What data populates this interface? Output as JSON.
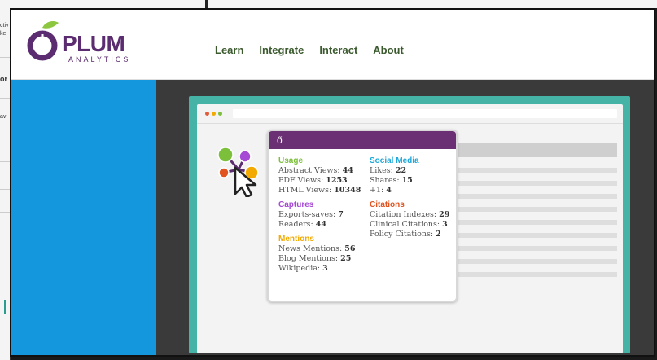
{
  "background_window": {
    "fragments": [
      "ctiv",
      "ke",
      "or",
      "av"
    ]
  },
  "site": {
    "logo": {
      "name": "PLUM",
      "tagline": "ANALYTICS"
    },
    "nav": [
      {
        "label": "Learn"
      },
      {
        "label": "Integrate"
      },
      {
        "label": "Interact"
      },
      {
        "label": "About"
      }
    ]
  },
  "card": {
    "icon": "ő",
    "usage": {
      "label": "Usage",
      "items": [
        {
          "name": "Abstract Views:",
          "value": "44"
        },
        {
          "name": "PDF Views:",
          "value": "1253"
        },
        {
          "name": "HTML Views:",
          "value": "10348"
        }
      ]
    },
    "captures": {
      "label": "Captures",
      "items": [
        {
          "name": "Exports-saves:",
          "value": "7"
        },
        {
          "name": "Readers:",
          "value": "44"
        }
      ]
    },
    "mentions": {
      "label": "Mentions",
      "items": [
        {
          "name": "News Mentions:",
          "value": "56"
        },
        {
          "name": "Blog Mentions:",
          "value": "25"
        },
        {
          "name": "Wikipedia:",
          "value": "3"
        }
      ]
    },
    "social_media": {
      "label": "Social Media",
      "items": [
        {
          "name": "Likes:",
          "value": "22"
        },
        {
          "name": "Shares:",
          "value": "15"
        },
        {
          "name": "+1:",
          "value": "4"
        }
      ]
    },
    "citations": {
      "label": "Citations",
      "items": [
        {
          "name": "Citation Indexes:",
          "value": "29"
        },
        {
          "name": "Clinical Citations:",
          "value": "3"
        },
        {
          "name": "Policy Citations:",
          "value": "2"
        }
      ]
    }
  },
  "colors": {
    "usage": "#7cbf3a",
    "captures": "#a64ad6",
    "mentions": "#f2a900",
    "social": "#1ea7d8",
    "citations": "#e2541f",
    "plum": "#5b2c6f",
    "nav_green": "#3b5a2e",
    "blue_panel": "#1497dc",
    "teal_frame": "#45b4a6"
  }
}
